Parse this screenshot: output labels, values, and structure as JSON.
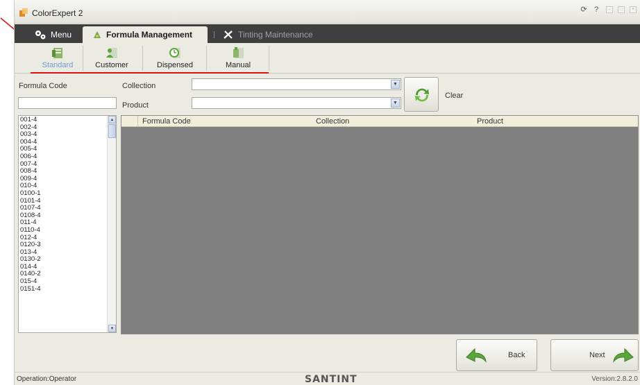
{
  "app": {
    "title": "ColorExpert 2"
  },
  "tabs": [
    {
      "label": "Menu",
      "icon": "gears-icon"
    },
    {
      "label": "Formula Management",
      "icon": "formula-icon",
      "active": true
    },
    {
      "label": "Tinting Maintenance",
      "icon": "tools-icon"
    }
  ],
  "subtabs": [
    {
      "label": "Standard",
      "icon": "standard-icon",
      "active": true
    },
    {
      "label": "Customer",
      "icon": "customer-icon"
    },
    {
      "label": "Dispensed",
      "icon": "clock-icon"
    },
    {
      "label": "Manual",
      "icon": "manual-icon"
    }
  ],
  "filters": {
    "formula_code_label": "Formula Code",
    "formula_code_value": "",
    "collection_label": "Collection",
    "collection_value": "",
    "product_label": "Product",
    "product_value": "",
    "clear_label": "Clear"
  },
  "formula_list": [
    "001-4",
    "002-4",
    "003-4",
    "004-4",
    "005-4",
    "006-4",
    "007-4",
    "008-4",
    "009-4",
    "010-4",
    "0100-1",
    "0101-4",
    "0107-4",
    "0108-4",
    "011-4",
    "0110-4",
    "012-4",
    "0120-3",
    "013-4",
    "0130-2",
    "014-4",
    "0140-2",
    "015-4",
    "0151-4"
  ],
  "grid": {
    "columns": [
      "Formula Code",
      "Collection",
      "Product"
    ]
  },
  "nav": {
    "back_label": "Back",
    "next_label": "Next"
  },
  "status": {
    "operation": "Operation:Operator",
    "logo": "SANTINT",
    "version": "Version:2.8.2.0"
  },
  "colors": {
    "accent_red": "#e01010",
    "tab_bar": "#3f3f3f",
    "grid_bg": "#808080",
    "icon_green": "#5aa63a"
  }
}
